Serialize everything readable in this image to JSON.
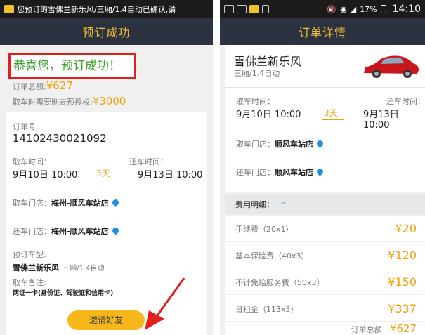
{
  "left": {
    "status_text": "您预订的雪佛兰新乐风/三厢/1.4自动已确认,请",
    "title": "预订成功",
    "success_message": "恭喜您，预订成功！",
    "order_total_label": "订单总额:",
    "order_total_value": "¥627",
    "preauth_label": "取车时需要刷去预授权:",
    "preauth_value": "¥3000",
    "order_no_label": "订单号:",
    "order_no": "14102430021092",
    "pickup_time_label": "取车时间：",
    "pickup_time": "9月10日 10:00",
    "days": "3天",
    "return_time_label": "还车时间：",
    "return_time": "9月13日 10:00",
    "pickup_store_label": "取车门店：",
    "pickup_store": "梅州-顺风车站店",
    "return_store_label": "还车门店：",
    "return_store": "梅州-顺风车站店",
    "car_type_label": "预订车型:",
    "car_name": "雪佛兰新乐风",
    "car_spec": "三厢/1.4自动",
    "note_label": "取车备注:",
    "note": "两证一卡(身份证、驾驶证和信用卡)",
    "invite_button": "邀请好友"
  },
  "right": {
    "status_battery": "17%",
    "status_time": "14:10",
    "title": "订单详情",
    "car_name": "雪佛兰新乐风",
    "car_spec": "三厢/1.4自动",
    "pickup_time_label": "取车时间：",
    "pickup_time": "9月10日 10:00",
    "days": "3天",
    "return_time_label": "还车时间：",
    "return_time": "9月13日 10:00",
    "pickup_store_label": "取车门店：",
    "pickup_store": "顺风车站店",
    "return_store_label": "还车门店：",
    "return_store": "顺风车站店",
    "fee_section_label": "费用明细：",
    "fees": [
      {
        "label": "手续费（20x1）",
        "amount": "¥20"
      },
      {
        "label": "基本保险费（40x3）",
        "amount": "¥120"
      },
      {
        "label": "不计免赔服务费（50x3）",
        "amount": "¥150"
      },
      {
        "label": "日租金（113x3）",
        "amount": "¥337"
      }
    ],
    "order_total_label": "订单总额",
    "order_total_value": "¥627"
  },
  "colors": {
    "accent": "#f0a20c",
    "title_text": "#f3c02f",
    "header_bg": "#2b3240",
    "success_green": "#3aa12e",
    "highlight_red": "#e0201a",
    "pin_blue": "#1e8ee6"
  }
}
